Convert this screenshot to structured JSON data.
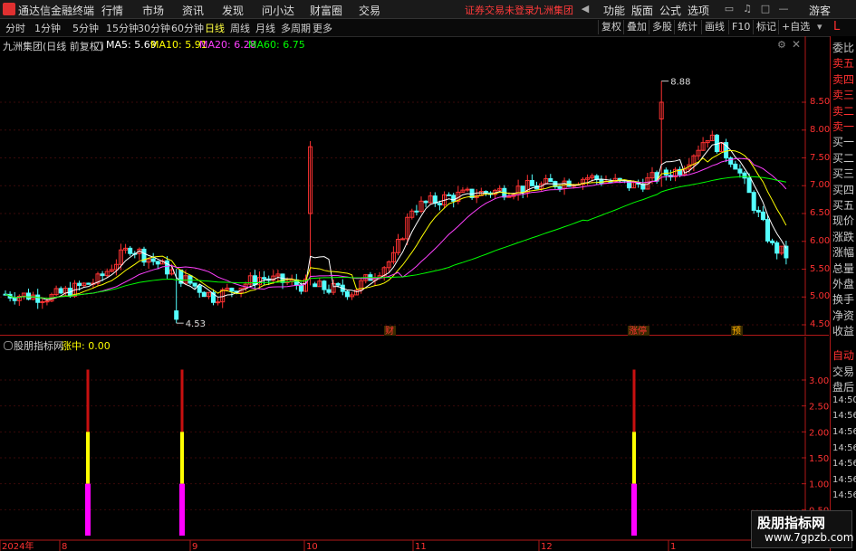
{
  "topbar": {
    "app_title": "通达信金融终端",
    "menus": [
      "行情",
      "市场",
      "资讯",
      "发现",
      "问小达",
      "财富圈",
      "交易"
    ],
    "notice": "证券交易未登录",
    "stock_name": "九洲集团",
    "right_menus": [
      "功能",
      "版面",
      "公式",
      "选项"
    ],
    "user": "游客"
  },
  "tabs": {
    "periods": [
      "分时",
      "1分钟",
      "5分钟",
      "15分钟",
      "30分钟",
      "60分钟",
      "日线",
      "周线",
      "月线",
      "多周期",
      "更多"
    ],
    "active": "日线",
    "right_tools": [
      "复权",
      "叠加",
      "多股",
      "统计",
      "画线",
      "F10",
      "标记",
      "+自选"
    ]
  },
  "main_chart": {
    "title": "九洲集团(日线 前复权)",
    "ma_labels": [
      "MA5: 5.69",
      "MA10: 5.91",
      "MA20: 6.28",
      "MA60: 6.75"
    ],
    "ma_colors": [
      "#ffffff",
      "#ffff00",
      "#ff40ff",
      "#00ff00"
    ],
    "y_ticks": [
      "8.50",
      "8.00",
      "7.50",
      "7.00",
      "6.50",
      "6.00",
      "5.50",
      "5.00",
      "4.50"
    ],
    "high_label": "8.88",
    "low_label": "4.53",
    "event_tags": [
      "财",
      "涨停",
      "预"
    ]
  },
  "indicator": {
    "name": "股朋指标网",
    "value_label": "涨中: 0.00",
    "y_ticks": [
      "3.00",
      "2.50",
      "2.00",
      "1.50",
      "1.00",
      "0.50"
    ]
  },
  "x_axis": {
    "labels": [
      "2024年",
      "8",
      "9",
      "10",
      "11",
      "12",
      "1"
    ]
  },
  "right_panel": {
    "labels": [
      "委比",
      "卖五",
      "卖四",
      "卖三",
      "卖二",
      "卖一",
      "买一",
      "买二",
      "买三",
      "买四",
      "买五",
      "现价",
      "涨跌",
      "涨幅",
      "总量",
      "外盘",
      "换手",
      "净资",
      "收益"
    ],
    "lower_labels": [
      "自动",
      "交易",
      "盘后",
      "14:50",
      "14:56",
      "14:56",
      "14:56",
      "14:56",
      "14:56",
      "14:56"
    ]
  },
  "watermark": {
    "line1": "股朋指标网",
    "line2": "www.7gpzb.com"
  },
  "colors": {
    "up": "#ff3232",
    "down": "#54ffff",
    "bar_red": "#c81010",
    "bar_yellow": "#ffff00",
    "bar_magenta": "#ff00ff"
  }
}
